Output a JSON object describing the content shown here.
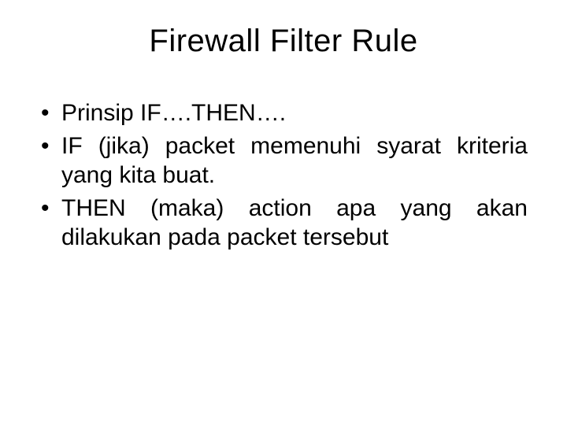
{
  "title": "Firewall Filter Rule",
  "bullets": [
    "Prinsip IF….THEN….",
    "IF (jika) packet memenuhi syarat kriteria yang kita buat.",
    "THEN (maka) action apa yang akan dilakukan pada packet tersebut"
  ]
}
